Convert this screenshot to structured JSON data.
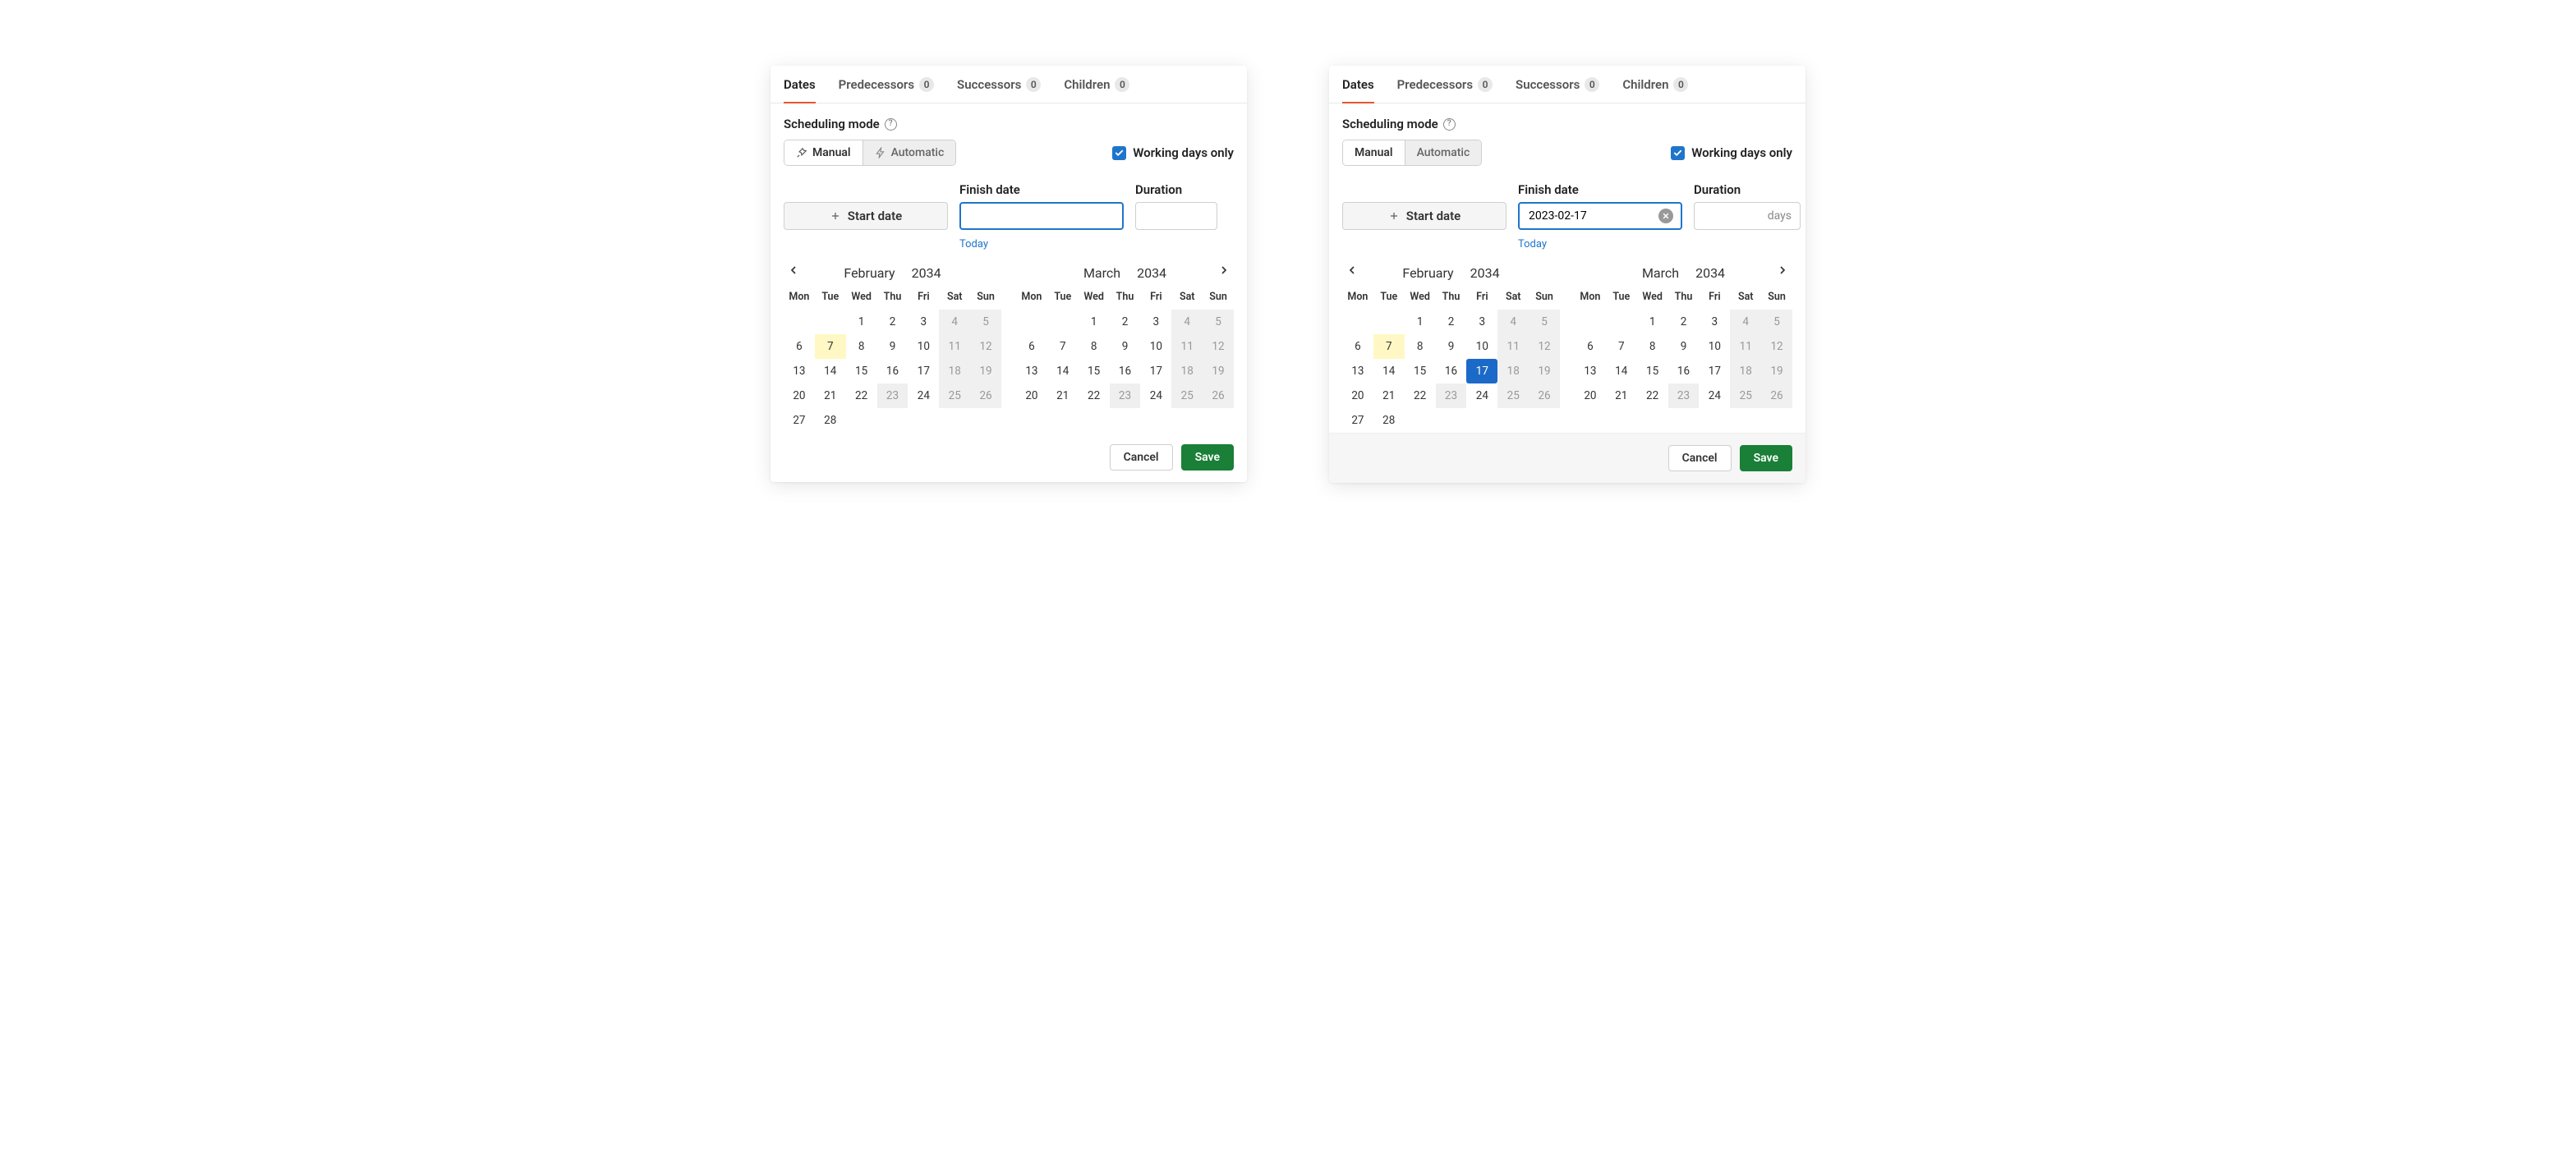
{
  "tabs": {
    "dates": "Dates",
    "predecessors": "Predecessors",
    "predecessors_count": "0",
    "successors": "Successors",
    "successors_count": "0",
    "children": "Children",
    "children_count": "0"
  },
  "scheduling": {
    "label": "Scheduling mode",
    "manual": "Manual",
    "automatic": "Automatic"
  },
  "working_days_only": "Working days only",
  "start_date_btn": "Start date",
  "finish_date_label": "Finish date",
  "duration_label": "Duration",
  "duration_placeholder": "days",
  "today_link": "Today",
  "weekdays": [
    "Mon",
    "Tue",
    "Wed",
    "Thu",
    "Fri",
    "Sat",
    "Sun"
  ],
  "cal": {
    "left_month": "February",
    "left_year": "2034",
    "right_month": "March",
    "right_year": "2034",
    "feb": {
      "first_wd": 3,
      "days": 28,
      "non_working": [
        23
      ],
      "today": 7
    },
    "march": {
      "first_wd": 3,
      "days": 26,
      "non_working": [
        23
      ]
    }
  },
  "buttons": {
    "cancel": "Cancel",
    "save": "Save"
  },
  "right_panel": {
    "finish_value": "2023-02-17",
    "selected_day_feb": 17
  }
}
